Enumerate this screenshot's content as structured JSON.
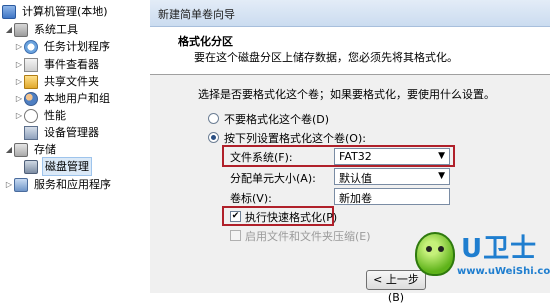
{
  "tree": {
    "root": "计算机管理(本地)",
    "system_tools": "系统工具",
    "task_scheduler": "任务计划程序",
    "event_viewer": "事件查看器",
    "shared_folders": "共享文件夹",
    "local_users": "本地用户和组",
    "performance": "性能",
    "device_manager": "设备管理器",
    "storage": "存储",
    "disk_management": "磁盘管理",
    "services_apps": "服务和应用程序"
  },
  "wizard": {
    "window_title": "新建简单卷向导",
    "header_title": "格式化分区",
    "header_subtitle": "要在这个磁盘分区上储存数据，您必须先将其格式化。",
    "prompt": "选择是否要格式化这个卷；如果要格式化，要使用什么设置。",
    "opt_no_format": "不要格式化这个卷(D)",
    "opt_format": "按下列设置格式化这个卷(O):",
    "fs_label": "文件系统(F):",
    "fs_value": "FAT32",
    "alloc_label": "分配单元大小(A):",
    "alloc_value": "默认值",
    "vol_label": "卷标(V):",
    "vol_value": "新加卷",
    "quick_format": "执行快速格式化(P)",
    "compression": "启用文件和文件夹压缩(E)",
    "back_button": "< 上一步(B)"
  },
  "watermark": {
    "title": "U卫士",
    "url": "www.uWeiShi.com"
  },
  "colors": {
    "highlight_border": "#b0202a",
    "logo_blue": "#1f7ecf"
  }
}
